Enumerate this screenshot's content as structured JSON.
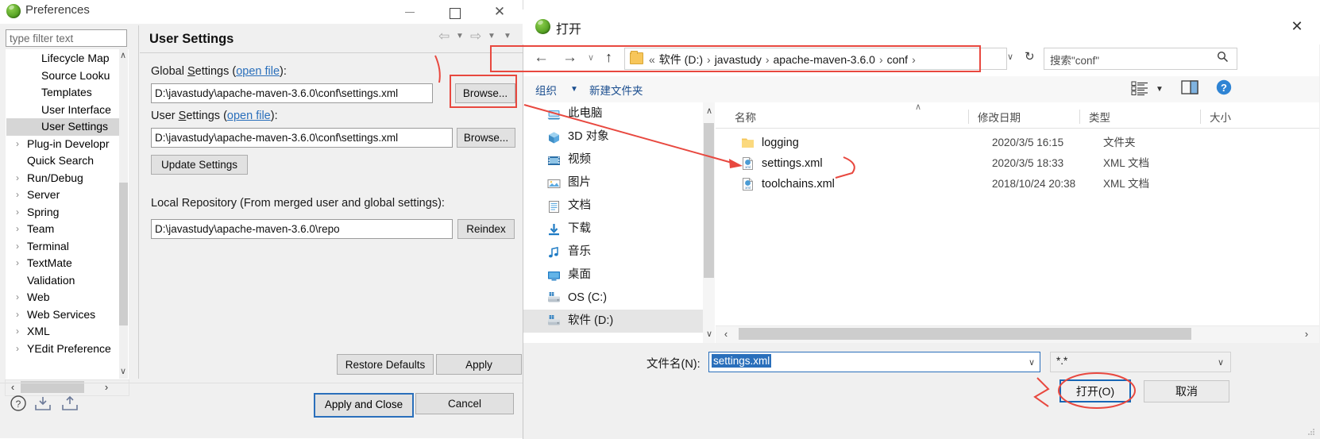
{
  "preferences": {
    "title": "Preferences",
    "window_buttons": {
      "minimize": "minimize-icon",
      "maximize": "maximize-icon",
      "close": "✕"
    },
    "filter": {
      "placeholder": "type filter text",
      "value": ""
    },
    "tree_items": [
      {
        "label": "Lifecycle Map",
        "arrow": "",
        "indent": true,
        "selected": false
      },
      {
        "label": "Source Looku",
        "arrow": "",
        "indent": true,
        "selected": false
      },
      {
        "label": "Templates",
        "arrow": "",
        "indent": true,
        "selected": false
      },
      {
        "label": "User Interface",
        "arrow": "",
        "indent": true,
        "selected": false
      },
      {
        "label": "User Settings",
        "arrow": "",
        "indent": true,
        "selected": true
      },
      {
        "label": "Plug-in Developr",
        "arrow": "›",
        "indent": false,
        "selected": false
      },
      {
        "label": "Quick Search",
        "arrow": "",
        "indent": false,
        "selected": false
      },
      {
        "label": "Run/Debug",
        "arrow": "›",
        "indent": false,
        "selected": false
      },
      {
        "label": "Server",
        "arrow": "›",
        "indent": false,
        "selected": false
      },
      {
        "label": "Spring",
        "arrow": "›",
        "indent": false,
        "selected": false
      },
      {
        "label": "Team",
        "arrow": "›",
        "indent": false,
        "selected": false
      },
      {
        "label": "Terminal",
        "arrow": "›",
        "indent": false,
        "selected": false
      },
      {
        "label": "TextMate",
        "arrow": "›",
        "indent": false,
        "selected": false
      },
      {
        "label": "Validation",
        "arrow": "",
        "indent": false,
        "selected": false
      },
      {
        "label": "Web",
        "arrow": "›",
        "indent": false,
        "selected": false
      },
      {
        "label": "Web Services",
        "arrow": "›",
        "indent": false,
        "selected": false
      },
      {
        "label": "XML",
        "arrow": "›",
        "indent": false,
        "selected": false
      },
      {
        "label": "YEdit Preference",
        "arrow": "›",
        "indent": false,
        "selected": false
      }
    ],
    "tree_scroll": {
      "up": "∧",
      "down": "∨",
      "left": "‹",
      "right": "›"
    },
    "panel": {
      "heading": "User Settings",
      "nav": {
        "back": "⇦",
        "back_dd": "▼",
        "forward": "⇨",
        "forward_dd": "▼",
        "menu": "▼"
      },
      "global_label_a": "Global ",
      "global_label_s": "S",
      "global_label_b": "ettings (",
      "global_link": "open file",
      "global_label_c": "):",
      "global_value": "D:\\javastudy\\apache-maven-3.6.0\\conf\\settings.xml",
      "browse1": "Browse...",
      "user_label_a": "User ",
      "user_label_s": "S",
      "user_label_b": "ettings (",
      "user_link": "open file",
      "user_label_c": "):",
      "user_value": "D:\\javastudy\\apache-maven-3.6.0\\conf\\settings.xml",
      "browse2": "Browse...",
      "update_settings": "Update Settings",
      "local_label": "Local Repository (From merged user and global settings):",
      "local_value": "D:\\javastudy\\apache-maven-3.6.0\\repo",
      "reindex": "Reindex"
    },
    "restore_defaults": "Restore Defaults",
    "apply": "Apply",
    "apply_and_close": "Apply and Close",
    "cancel": "Cancel",
    "footer_icons": [
      "help-icon",
      "import-icon",
      "export-icon"
    ]
  },
  "open_dialog": {
    "title": "打开",
    "close": "✕",
    "nav": {
      "back": "←",
      "forward": "→",
      "history_dd": "∨",
      "up": "↑",
      "breadcrumb_prefix": "«",
      "breadcrumb": [
        "软件 (D:)",
        "javastudy",
        "apache-maven-3.6.0",
        "conf"
      ],
      "breadcrumb_sep": "›",
      "breadcrumb_dd": "∨",
      "refresh": "↻",
      "search_placeholder": "搜索\"conf\"",
      "search_icon": "search-icon"
    },
    "toolbar": {
      "organize": "组织",
      "organize_dd": "▼",
      "new_folder": "新建文件夹",
      "view_icon": "list-view-icon",
      "view_dd": "▼",
      "preview_pane_icon": "preview-pane-icon",
      "help_icon": "help-icon"
    },
    "nav_pane": [
      {
        "label": "此电脑",
        "icon": "this-pc-icon",
        "selected": false
      },
      {
        "label": "3D 对象",
        "icon": "3d-objects-icon",
        "selected": false
      },
      {
        "label": "视频",
        "icon": "videos-icon",
        "selected": false
      },
      {
        "label": "图片",
        "icon": "pictures-icon",
        "selected": false
      },
      {
        "label": "文档",
        "icon": "documents-icon",
        "selected": false
      },
      {
        "label": "下载",
        "icon": "downloads-icon",
        "selected": false
      },
      {
        "label": "音乐",
        "icon": "music-icon",
        "selected": false
      },
      {
        "label": "桌面",
        "icon": "desktop-icon",
        "selected": false
      },
      {
        "label": "OS (C:)",
        "icon": "drive-icon",
        "selected": false
      },
      {
        "label": "软件 (D:)",
        "icon": "drive-icon",
        "selected": true
      }
    ],
    "nav_scroll": {
      "up": "∧",
      "down": "∨"
    },
    "columns": [
      "名称",
      "修改日期",
      "类型",
      "大小"
    ],
    "sort_caret": "∧",
    "files": [
      {
        "name": "logging",
        "date": "2020/3/5 16:15",
        "type": "文件夹",
        "icon": "folder-icon",
        "selected": false
      },
      {
        "name": "settings.xml",
        "date": "2020/3/5 18:33",
        "type": "XML 文档",
        "icon": "xml-file-icon",
        "selected": false
      },
      {
        "name": "toolchains.xml",
        "date": "2018/10/24 20:38",
        "type": "XML 文档",
        "icon": "xml-file-icon",
        "selected": false
      }
    ],
    "list_scroll": {
      "left": "‹",
      "right": "›"
    },
    "footer": {
      "filename_label": "文件名(N):",
      "filename_value": "settings.xml",
      "filename_dd": "∨",
      "filter_value": "*.*",
      "filter_dd": "∨",
      "open_button": "打开(O)",
      "cancel_button": "取消"
    }
  },
  "annotations": {
    "accent_color": "#e8483f",
    "highlight_boxes": [
      "breadcrumb-box",
      "browse-button-box"
    ],
    "ellipse": "open-button-ellipse",
    "arrow_target": "settings.xml"
  }
}
